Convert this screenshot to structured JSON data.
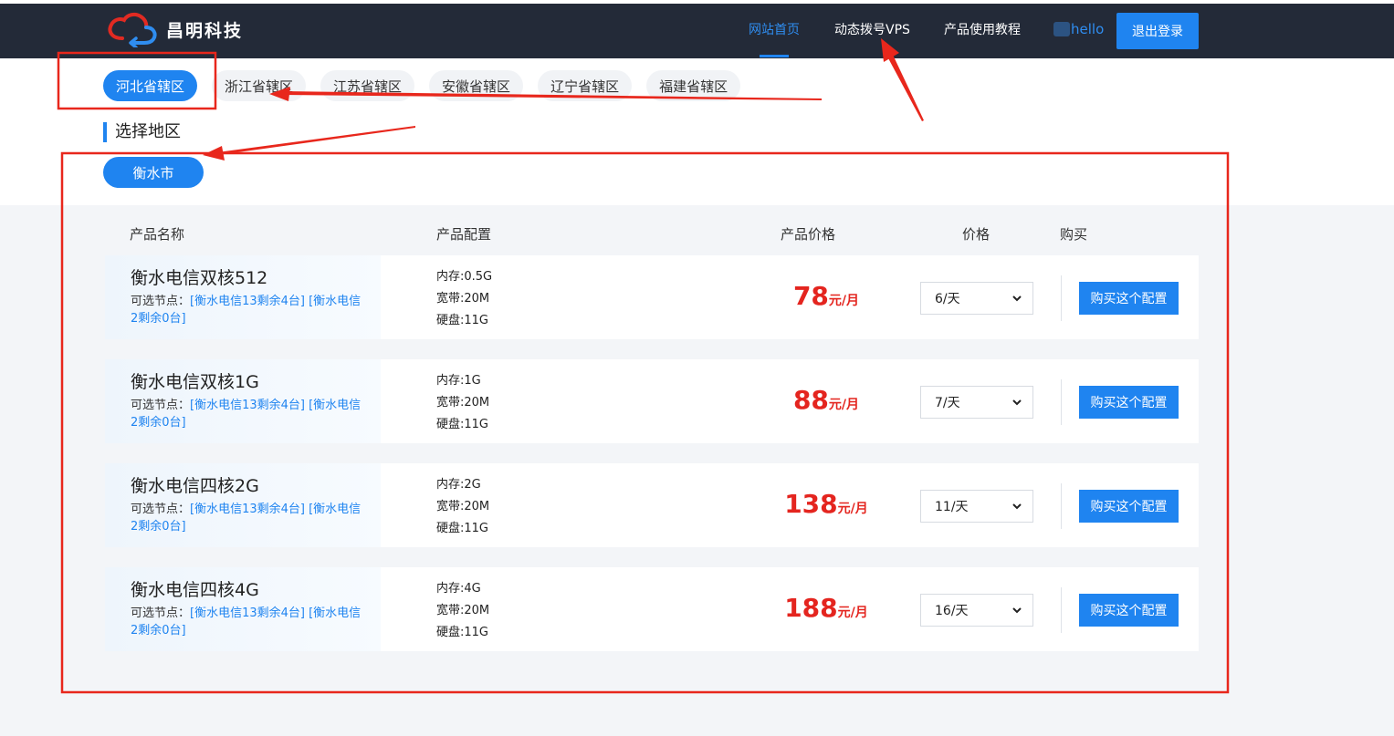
{
  "header": {
    "logo_text": "昌明科技",
    "nav": {
      "home": "网站首页",
      "vps": "动态拨号VPS",
      "guide": "产品使用教程"
    },
    "user": "hello",
    "logout": "退出登录"
  },
  "provinces": [
    "河北省辖区",
    "浙江省辖区",
    "江苏省辖区",
    "安徽省辖区",
    "辽宁省辖区",
    "福建省辖区"
  ],
  "section_title": "选择地区",
  "city": "衡水市",
  "table": {
    "headers": {
      "name": "产品名称",
      "config": "产品配置",
      "price": "产品价格",
      "period": "价格",
      "buy": "购买"
    },
    "rows": [
      {
        "name": "衡水电信双核512",
        "nodes_label": "可选节点：",
        "nodes": "[衡水电信13剩余4台] [衡水电信2剩余0台]",
        "mem": "内存:0.5G",
        "bw": "宽带:20M",
        "disk": "硬盘:11G",
        "price": "78",
        "unit": "元/月",
        "period": "6/天",
        "buy": "购买这个配置"
      },
      {
        "name": "衡水电信双核1G",
        "nodes_label": "可选节点：",
        "nodes": "[衡水电信13剩余4台] [衡水电信2剩余0台]",
        "mem": "内存:1G",
        "bw": "宽带:20M",
        "disk": "硬盘:11G",
        "price": "88",
        "unit": "元/月",
        "period": "7/天",
        "buy": "购买这个配置"
      },
      {
        "name": "衡水电信四核2G",
        "nodes_label": "可选节点：",
        "nodes": "[衡水电信13剩余4台] [衡水电信2剩余0台]",
        "mem": "内存:2G",
        "bw": "宽带:20M",
        "disk": "硬盘:11G",
        "price": "138",
        "unit": "元/月",
        "period": "11/天",
        "buy": "购买这个配置"
      },
      {
        "name": "衡水电信四核4G",
        "nodes_label": "可选节点：",
        "nodes": "[衡水电信13剩余4台] [衡水电信2剩余0台]",
        "mem": "内存:4G",
        "bw": "宽带:20M",
        "disk": "硬盘:11G",
        "price": "188",
        "unit": "元/月",
        "period": "16/天",
        "buy": "购买这个配置"
      }
    ]
  },
  "colors": {
    "accent": "#1f84f0",
    "price": "#e4251f",
    "topbar": "#232a38",
    "annotation": "#e8271c"
  }
}
